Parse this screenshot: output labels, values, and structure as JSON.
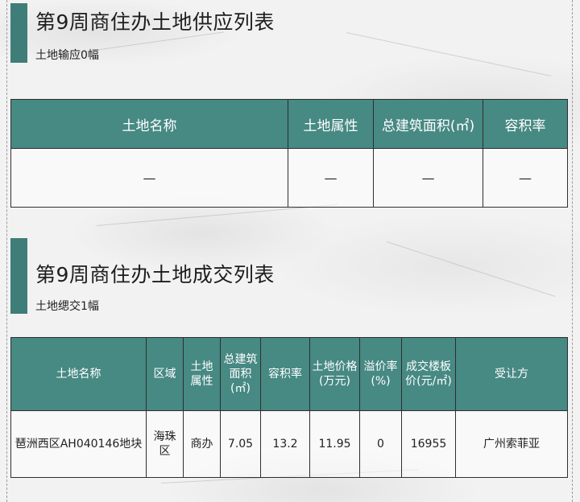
{
  "supply": {
    "title": "第9周商住办土地供应列表",
    "subtitle": "土地输应0幅",
    "headers": [
      "土地名称",
      "土地属性",
      "总建筑面积(㎡)",
      "容积率"
    ],
    "row": [
      "—",
      "—",
      "—",
      "—"
    ]
  },
  "deal": {
    "title": "第9周商住办土地成交列表",
    "subtitle": "土地缌交1幅",
    "headers": [
      "土地名称",
      "区域",
      "土地属性",
      "总建筑面积(㎡)",
      "容积率",
      "土地价格(万元)",
      "溢价率(%)",
      "成交楼板价(元/㎡)",
      "受让方"
    ],
    "row": [
      "琶洲西区AH040146地块",
      "海珠区",
      "商办",
      "7.05",
      "13.2",
      "11.95",
      "0",
      "16955",
      "广州索菲亚"
    ]
  },
  "colors": {
    "header_bg": "#478983",
    "accent_bar": "#3f7d78"
  }
}
